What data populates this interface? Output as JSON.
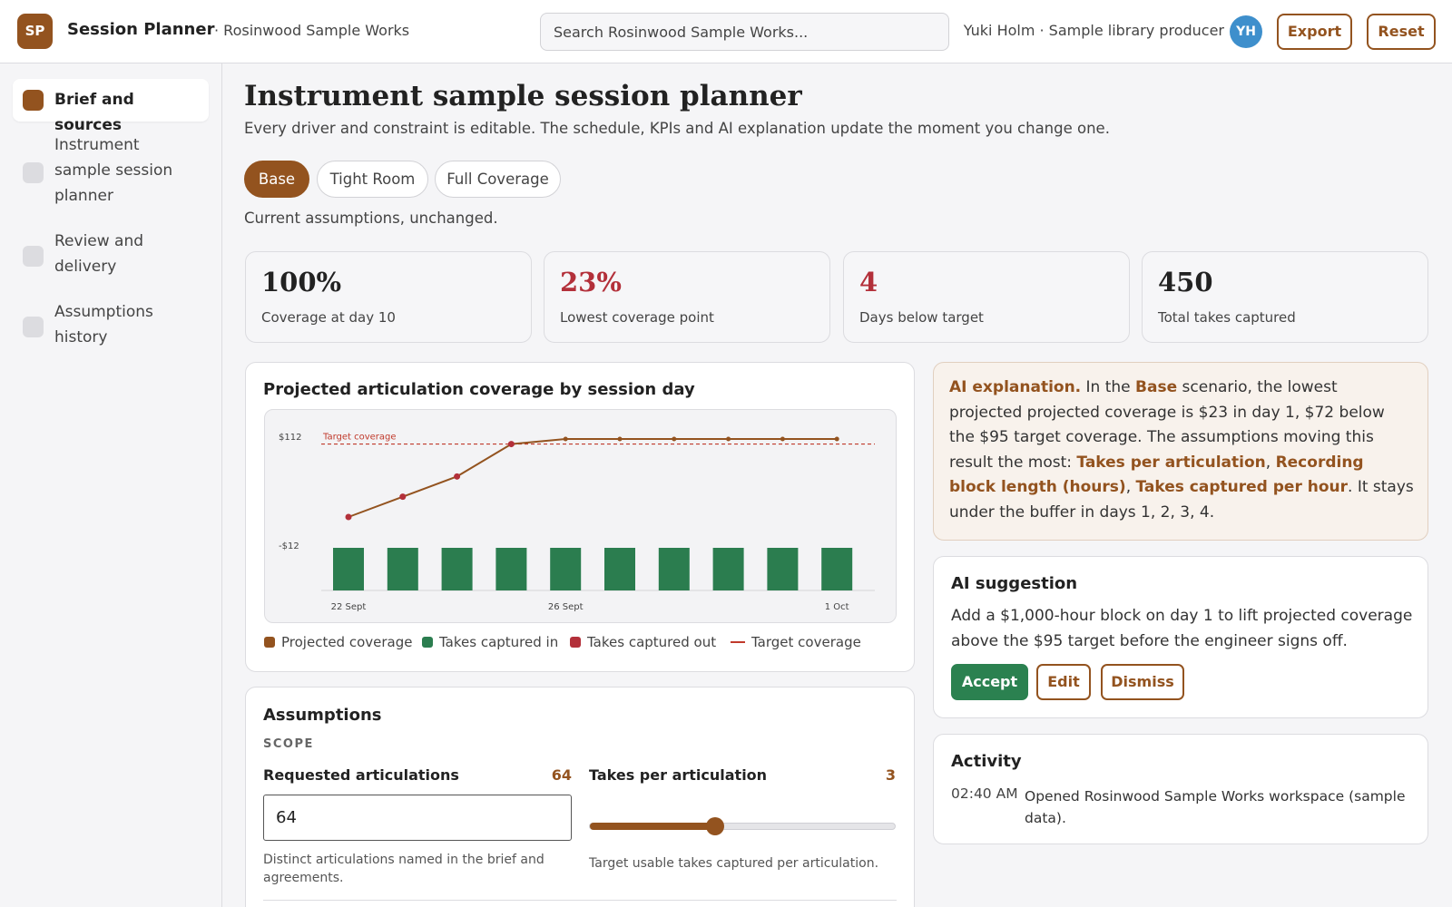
{
  "app": {
    "logo": "SP",
    "title": "Session Planner",
    "workspace": "· Rosinwood Sample Works",
    "search_placeholder": "Search Rosinwood Sample Works...",
    "user": "Yuki Holm · Sample library producer",
    "avatar_initials": "YH",
    "export_label": "Export",
    "reset_label": "Reset"
  },
  "sidebar": {
    "items": [
      {
        "label": "Brief and sources",
        "active": true
      },
      {
        "label": "Instrument sample session planner",
        "active": false
      },
      {
        "label": "Review and delivery",
        "active": false
      },
      {
        "label": "Assumptions history",
        "active": false
      }
    ]
  },
  "page": {
    "title": "Instrument sample session planner",
    "subtitle": "Every driver and constraint is editable. The schedule, KPIs and AI explanation update the moment you change one.",
    "scenarios": [
      {
        "label": "Base",
        "active": true
      },
      {
        "label": "Tight Room",
        "active": false
      },
      {
        "label": "Full Coverage",
        "active": false
      }
    ],
    "scenario_note": "Current assumptions, unchanged."
  },
  "kpis": [
    {
      "value": "100%",
      "label": "Coverage at day 10",
      "color": "#222222"
    },
    {
      "value": "23%",
      "label": "Lowest coverage point",
      "color": "#b3303a"
    },
    {
      "value": "4",
      "label": "Days below target",
      "color": "#b3303a"
    },
    {
      "value": "450",
      "label": "Total takes captured",
      "color": "#222222"
    }
  ],
  "chart_card": {
    "title": "Projected articulation coverage by session day"
  },
  "chart_data": {
    "type": "bar",
    "x_tick_labels": [
      "22 Sept",
      "26 Sept",
      "1 Oct"
    ],
    "y_tick_labels": [
      "$112",
      "-$12"
    ],
    "ylim": [
      -12,
      112
    ],
    "categories": [
      "d1",
      "d2",
      "d3",
      "d4",
      "d5",
      "d6",
      "d7",
      "d8",
      "d9",
      "d10"
    ],
    "series": [
      {
        "name": "Projected coverage",
        "type": "line",
        "color": "#93531f",
        "values": [
          23,
          43,
          63,
          95,
          100,
          100,
          100,
          100,
          100,
          100
        ]
      },
      {
        "name": "Takes captured in",
        "type": "bar",
        "color": "#2b7d4f",
        "values": [
          45,
          45,
          45,
          45,
          45,
          45,
          45,
          45,
          45,
          45
        ]
      },
      {
        "name": "Takes captured out",
        "type": "bar",
        "color": "#b3303a",
        "values": [
          0,
          0,
          0,
          0,
          0,
          0,
          0,
          0,
          0,
          0
        ]
      }
    ],
    "target": {
      "name": "Target coverage",
      "label": "Target coverage",
      "value": 95,
      "color": "#c0392b"
    },
    "bar_scale_max": 112,
    "grid": false,
    "legend_position": "bottom-left"
  },
  "assumptions": {
    "title": "Assumptions",
    "section": "SCOPE",
    "fields": [
      {
        "label": "Requested articulations",
        "value": "64",
        "input_value": "64",
        "help": "Distinct articulations named in the brief and agreements."
      },
      {
        "label": "Takes per articulation",
        "value": "3",
        "help": "Target usable takes captured per articulation.",
        "slider_fraction": 0.41
      }
    ]
  },
  "ai_explanation": {
    "lead": "AI explanation.",
    "t1": " In the ",
    "scenario": "Base",
    "t2": " scenario, the lowest projected projected coverage is $23 in day 1, $72 below the $95 target coverage. The assumptions moving this result the most: ",
    "driver1": "Takes per articulation",
    "sep1": ", ",
    "driver2": "Recording block length (hours)",
    "sep2": ", ",
    "driver3": "Takes captured per hour",
    "t3": ". It stays under the buffer in days 1, 2, 3, 4."
  },
  "ai_suggestion": {
    "title": "AI suggestion",
    "text": "Add a $1,000-hour block on day 1 to lift projected coverage above the $95 target before the engineer signs off.",
    "accept": "Accept",
    "edit": "Edit",
    "dismiss": "Dismiss"
  },
  "activity": {
    "title": "Activity",
    "entries": [
      {
        "time": "02:40 AM",
        "text": "Opened Rosinwood Sample Works workspace (sample data)."
      }
    ]
  }
}
